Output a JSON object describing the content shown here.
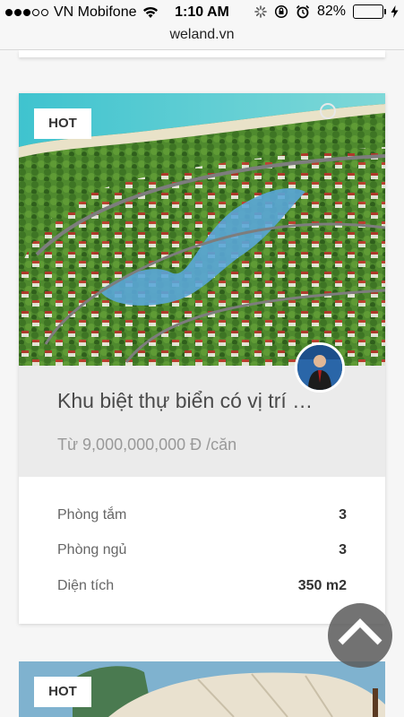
{
  "status_bar": {
    "carrier": "VN Mobifone",
    "time": "1:10 AM",
    "battery": "82%",
    "battery_level": 0.82
  },
  "url_bar": {
    "url": "weland.vn"
  },
  "listing": {
    "badge": "HOT",
    "title": "Khu biệt thự biển có vị trí …",
    "price": "Từ 9,000,000,000 Đ /căn",
    "specs": [
      {
        "label": "Phòng tắm",
        "value": "3"
      },
      {
        "label": "Phòng ngủ",
        "value": "3"
      },
      {
        "label": "Diện tích",
        "value": "350 m2"
      }
    ]
  },
  "next_listing": {
    "badge": "HOT"
  },
  "icons": {
    "signal": "signal-dots-icon",
    "wifi": "wifi-icon",
    "activity": "activity-spinner-icon",
    "rotation_lock": "rotation-lock-icon",
    "alarm": "alarm-icon",
    "battery": "battery-icon",
    "charging": "charging-bolt-icon",
    "scroll_top": "chevron-up-icon"
  },
  "colors": {
    "battery_fill": "#4cd964",
    "title_bg": "#ebebeb",
    "scroll_button": "#5a5a5a"
  }
}
